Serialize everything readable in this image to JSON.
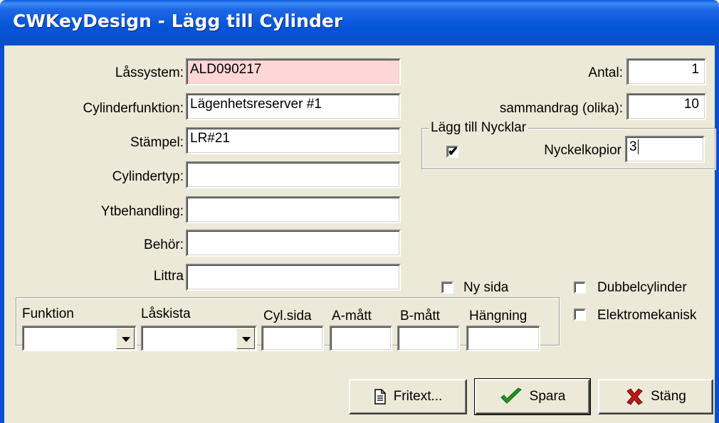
{
  "window": {
    "title": "CWKeyDesign - Lägg till Cylinder"
  },
  "form": {
    "lassystem_label": "Låssystem:",
    "lassystem_value": "ALD090217",
    "cylinderfunktion_label": "Cylinderfunktion:",
    "cylinderfunktion_value": "Lägenhetsreserver #1",
    "stampel_label": "Stämpel:",
    "stampel_value": "LR#21",
    "cylindertyp_label": "Cylindertyp:",
    "cylindertyp_value": "",
    "ytbehandling_label": "Ytbehandling:",
    "ytbehandling_value": "",
    "behor_label": "Behör:",
    "behor_value": "",
    "littra_label": "Littra",
    "littra_value": "",
    "antal_label": "Antal:",
    "antal_value": "1",
    "sammandrag_label": "sammandrag (olika):",
    "sammandrag_value": "10"
  },
  "nycklar_group": {
    "title": "Lägg till Nycklar",
    "checked": true,
    "nyckelkopior_label": "Nyckelkopior",
    "nyckelkopior_value": "3"
  },
  "options": {
    "ny_sida": {
      "label": "Ny sida",
      "checked": false
    },
    "dubbelcylinder": {
      "label": "Dubbelcylinder",
      "checked": false
    },
    "elektromekanisk": {
      "label": "Elektromekanisk",
      "checked": false
    }
  },
  "bottom_group": {
    "columns": [
      "Funktion",
      "Låskista",
      "Cyl.sida",
      "A-mått",
      "B-mått",
      "Hängning"
    ],
    "funktion_value": "",
    "laskista_value": "",
    "cylsida_value": "",
    "amatt_value": "",
    "bmatt_value": "",
    "hangning_value": ""
  },
  "buttons": {
    "fritext": "Fritext...",
    "spara": "Spara",
    "stang": "Stäng"
  },
  "icons": {
    "fritext": "document-icon",
    "spara": "checkmark-icon",
    "stang": "close-x-icon"
  },
  "colors": {
    "titlebar": "#0454d8",
    "lassystem_bg": "#ffd6d6",
    "window_bg": "#ece9d8",
    "check_green": "#1f9a1f",
    "x_red": "#c01818"
  }
}
